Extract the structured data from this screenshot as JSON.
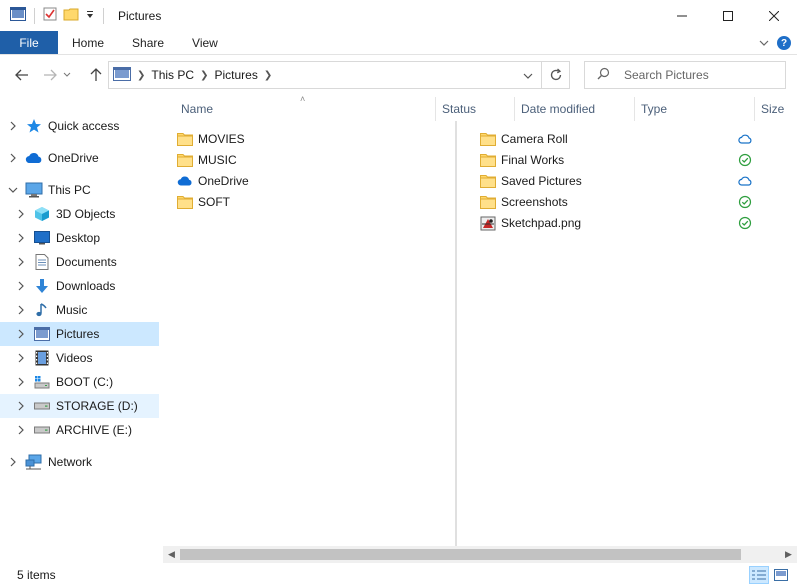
{
  "window": {
    "title": "Pictures"
  },
  "ribbon": {
    "tabs": [
      {
        "id": "file",
        "label": "File"
      },
      {
        "id": "home",
        "label": "Home"
      },
      {
        "id": "share",
        "label": "Share"
      },
      {
        "id": "view",
        "label": "View"
      }
    ]
  },
  "address": {
    "crumbs": [
      "This PC",
      "Pictures"
    ]
  },
  "search": {
    "placeholder": "Search Pictures"
  },
  "columns": [
    "Name",
    "Status",
    "Date modified",
    "Type",
    "Size"
  ],
  "sidebar": {
    "items": [
      {
        "label": "Quick access",
        "icon": "star-icon",
        "level": 0
      },
      {
        "label": "OneDrive",
        "icon": "cloud-icon",
        "level": 0
      },
      {
        "label": "This PC",
        "icon": "computer-icon",
        "level": 0,
        "expanded": true
      },
      {
        "label": "3D Objects",
        "icon": "cube-icon",
        "level": 1
      },
      {
        "label": "Desktop",
        "icon": "desktop-icon",
        "level": 1
      },
      {
        "label": "Documents",
        "icon": "document-icon",
        "level": 1
      },
      {
        "label": "Downloads",
        "icon": "download-icon",
        "level": 1
      },
      {
        "label": "Music",
        "icon": "music-icon",
        "level": 1
      },
      {
        "label": "Pictures",
        "icon": "pictures-icon",
        "level": 1,
        "selected": true
      },
      {
        "label": "Videos",
        "icon": "video-icon",
        "level": 1
      },
      {
        "label": "BOOT (C:)",
        "icon": "system-drive-icon",
        "level": 1
      },
      {
        "label": "STORAGE (D:)",
        "icon": "drive-icon",
        "level": 1,
        "hover": true
      },
      {
        "label": "ARCHIVE (E:)",
        "icon": "drive-icon",
        "level": 1
      },
      {
        "label": "Network",
        "icon": "network-icon",
        "level": 0
      }
    ]
  },
  "files_left": [
    {
      "name": "MOVIES",
      "icon": "folder-icon"
    },
    {
      "name": "MUSIC",
      "icon": "folder-icon"
    },
    {
      "name": "OneDrive",
      "icon": "cloud-icon"
    },
    {
      "name": "SOFT",
      "icon": "folder-icon"
    }
  ],
  "files_right": [
    {
      "name": "Camera Roll",
      "icon": "folder-icon",
      "status": "cloud"
    },
    {
      "name": "Final Works",
      "icon": "folder-icon",
      "status": "synced"
    },
    {
      "name": "Saved Pictures",
      "icon": "folder-icon",
      "status": "cloud"
    },
    {
      "name": "Screenshots",
      "icon": "folder-icon",
      "status": "synced"
    },
    {
      "name": "Sketchpad.png",
      "icon": "image-file-icon",
      "status": "synced"
    }
  ],
  "statusbar": {
    "item_count": "5 items"
  },
  "colors": {
    "file_tab": "#1f5fa8",
    "selected_bg": "#cce8ff",
    "hover_bg": "#e5f3ff",
    "folder": "#ffd86b",
    "cloud_status": "#1a73c8",
    "synced_status": "#2e9e3e",
    "header_text": "#4c607a"
  }
}
